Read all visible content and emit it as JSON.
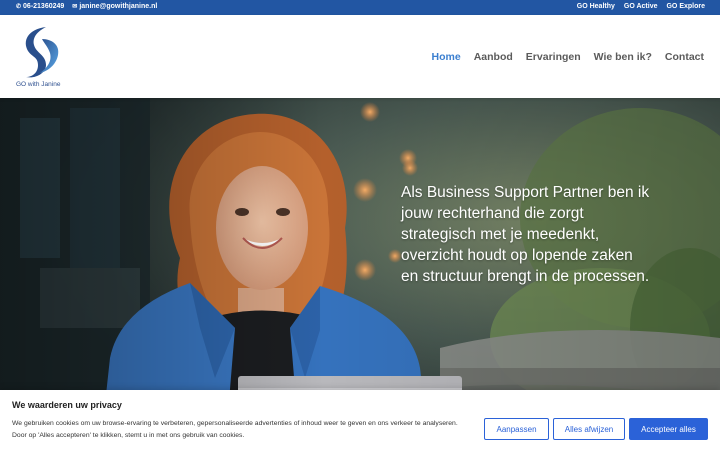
{
  "topbar": {
    "phone": "06-21360249",
    "email": "janine@gowithjanine.nl",
    "links": [
      "GO Healthy",
      "GO Active",
      "GO Explore"
    ]
  },
  "header": {
    "logo_text": "GO with Janine",
    "nav": [
      "Home",
      "Aanbod",
      "Ervaringen",
      "Wie ben ik?",
      "Contact"
    ],
    "active_nav": "Home"
  },
  "hero": {
    "tagline": "Als Business Support Partner ben ik jouw rechterhand die zorgt strategisch met je meedenkt, overzicht houdt op lopende zaken en structuur brengt in de processen."
  },
  "cookie_banner": {
    "title": "We waarderen uw privacy",
    "body": "We gebruiken cookies om uw browse-ervaring te verbeteren, gepersonaliseerde advertenties of inhoud weer te geven en ons verkeer te analyseren. Door op 'Alles accepteren' te klikken, stemt u in met ons gebruik van cookies.",
    "customize_label": "Aanpassen",
    "reject_label": "Alles afwijzen",
    "accept_label": "Accepteer alles"
  },
  "colors": {
    "topbar": "#2256a3",
    "nav_active": "#3b7fd0",
    "button": "#2b62d8"
  }
}
